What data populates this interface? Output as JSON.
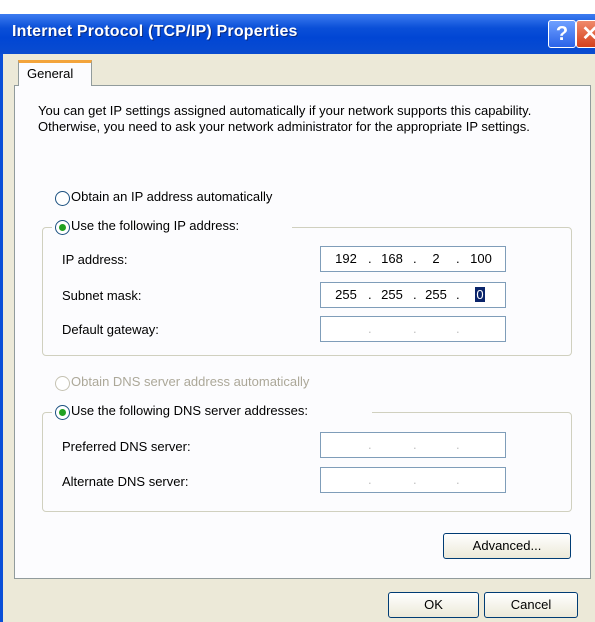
{
  "window": {
    "title": "Internet Protocol (TCP/IP) Properties",
    "help_glyph": "?",
    "close_glyph": "✕"
  },
  "tabs": [
    {
      "label": "General",
      "selected": true
    }
  ],
  "description": "You can get IP settings assigned automatically if your network supports this capability. Otherwise, you need to ask your network administrator for the appropriate IP settings.",
  "ip": {
    "auto_label": "Obtain an IP address automatically",
    "auto_selected": false,
    "manual_label": "Use the following IP address:",
    "manual_selected": true,
    "fields": [
      {
        "label": "IP address:",
        "octets": [
          "192",
          "168",
          "2",
          "100"
        ]
      },
      {
        "label": "Subnet mask:",
        "octets": [
          "255",
          "255",
          "255",
          "0"
        ]
      },
      {
        "label": "Default gateway:",
        "octets": [
          "",
          "",
          "",
          ""
        ]
      }
    ]
  },
  "dns": {
    "auto_label": "Obtain DNS server address automatically",
    "auto_enabled": false,
    "manual_label": "Use the following DNS server addresses:",
    "manual_selected": true,
    "fields": [
      {
        "label": "Preferred DNS server:",
        "octets": [
          "",
          "",
          "",
          ""
        ]
      },
      {
        "label": "Alternate DNS server:",
        "octets": [
          "",
          "",
          "",
          ""
        ]
      }
    ]
  },
  "buttons": {
    "advanced": "Advanced...",
    "ok": "OK",
    "cancel": "Cancel"
  },
  "colors": {
    "titlebar": "#0a4fd8",
    "dialog_bg": "#ece9d8",
    "tab_accent": "#f3a43b",
    "radio_dot": "#21a121"
  }
}
